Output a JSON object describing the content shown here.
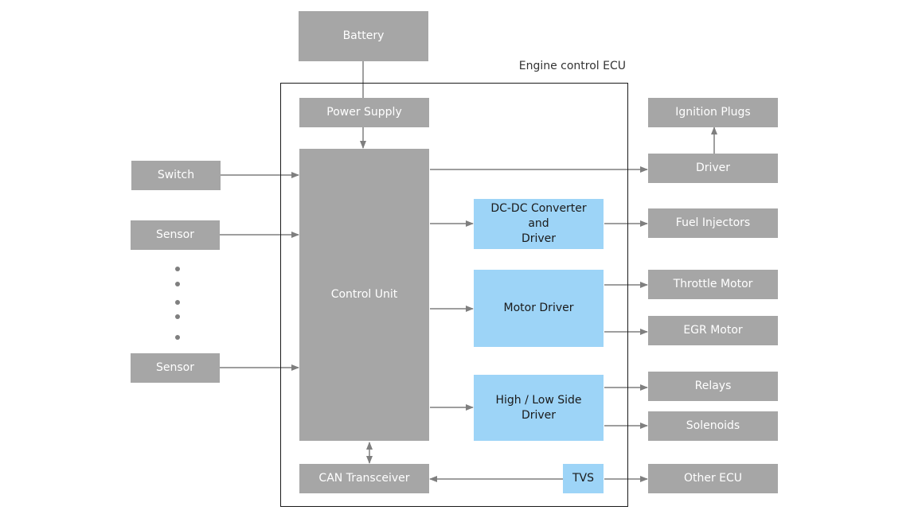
{
  "diagram": {
    "ecu_title": "Engine control ECU",
    "colors": {
      "gray_block": "#a6a6a6",
      "blue_block": "#9dd4f7",
      "line": "#7f7f7f",
      "frame": "#1a1a1a"
    },
    "blocks": {
      "battery": "Battery",
      "power_supply": "Power Supply",
      "control_unit": "Control Unit",
      "dcdc": "DC-DC Converter\nand\nDriver",
      "motor_driver": "Motor Driver",
      "hl_driver": "High / Low Side\nDriver",
      "can": "CAN Transceiver",
      "tvs": "TVS"
    },
    "inputs": [
      "Switch",
      "Sensor",
      "Sensor"
    ],
    "outputs": {
      "ignition": "Ignition Plugs",
      "driver": "Driver",
      "fuel": "Fuel Injectors",
      "throttle": "Throttle Motor",
      "egr": "EGR Motor",
      "relays": "Relays",
      "solenoids": "Solenoids",
      "other_ecu": "Other ECU"
    },
    "connections": [
      [
        "Battery",
        "Power Supply"
      ],
      [
        "Power Supply",
        "Control Unit"
      ],
      [
        "Switch",
        "Control Unit"
      ],
      [
        "Sensor",
        "Control Unit"
      ],
      [
        "Sensor",
        "Control Unit"
      ],
      [
        "Control Unit",
        "Driver"
      ],
      [
        "Driver",
        "Ignition Plugs"
      ],
      [
        "Control Unit",
        "DC-DC Converter and Driver"
      ],
      [
        "DC-DC Converter and Driver",
        "Fuel Injectors"
      ],
      [
        "Control Unit",
        "Motor Driver"
      ],
      [
        "Motor Driver",
        "Throttle Motor"
      ],
      [
        "Motor Driver",
        "EGR Motor"
      ],
      [
        "Control Unit",
        "High / Low Side Driver"
      ],
      [
        "High / Low Side Driver",
        "Relays"
      ],
      [
        "High / Low Side Driver",
        "Solenoids"
      ],
      [
        "Control Unit",
        "CAN Transceiver",
        "bidirectional"
      ],
      [
        "TVS",
        "CAN Transceiver"
      ],
      [
        "TVS",
        "Other ECU"
      ]
    ]
  }
}
